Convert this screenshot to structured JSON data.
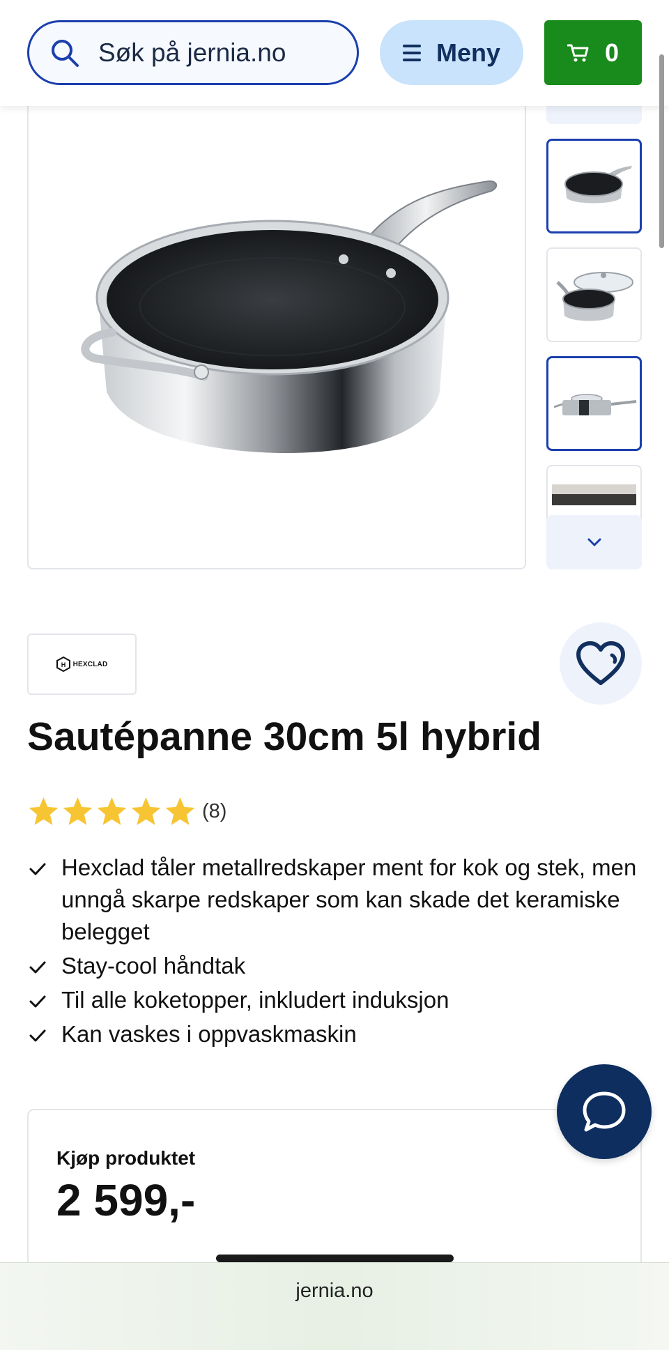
{
  "header": {
    "search_placeholder": "Søk på jernia.no",
    "menu_label": "Meny",
    "cart_count": "0",
    "accent_color": "#1b3fae",
    "cart_color": "#198a1c"
  },
  "product": {
    "brand": "HEXCLAD",
    "title": "Sautépanne 30cm 5l hybrid",
    "rating_count": "(8)",
    "rating_stars": 5,
    "features": [
      "Hexclad tåler metallredskaper ment for kok og stek, men unngå skarpe redskaper som kan skade det keramiske belegget",
      "Stay-cool håndtak",
      "Til alle koketopper, inkludert induksjon",
      "Kan vaskes i oppvaskmaskin"
    ]
  },
  "buy": {
    "label": "Kjøp produktet",
    "price": "2 599,-"
  },
  "browser": {
    "url": "jernia.no"
  },
  "icons": {
    "search": "search-icon",
    "menu": "hamburger-icon",
    "cart": "cart-icon",
    "favorite": "heart-icon",
    "chat": "chat-bubble-icon",
    "scroll_down": "chevron-down-icon"
  }
}
